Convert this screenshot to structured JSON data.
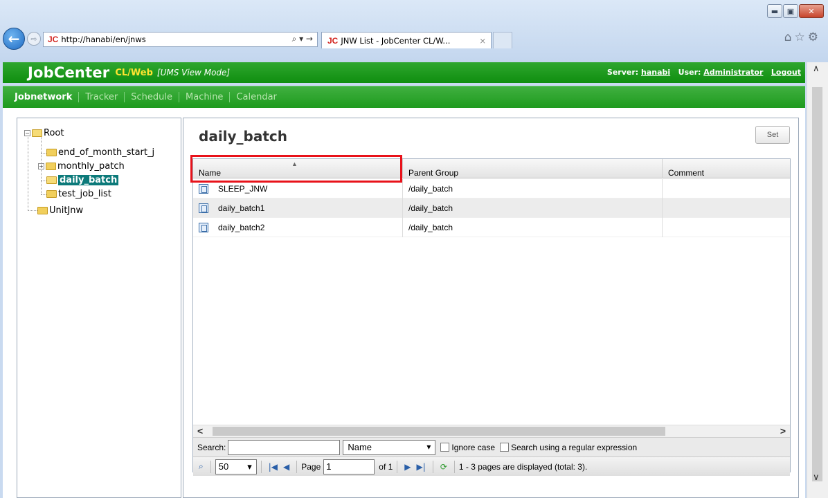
{
  "browser": {
    "url": "http://hanabi/en/jnws",
    "address_tools": "⌕ ▾ →",
    "tab_title": "JNW List - JobCenter CL/W...",
    "tab_close": "×",
    "favicon": "JC",
    "window_buttons": {
      "minimize": "▬",
      "maximize": "▣",
      "close": "✕"
    }
  },
  "app": {
    "logo": "JobCenter",
    "logo_sub": "CL/Web",
    "mode": "[UMS View Mode]",
    "server_label": "Server:",
    "server": "hanabi",
    "user_label": "User:",
    "user": "Administrator",
    "logout": "Logout"
  },
  "nav": [
    "Jobnetwork",
    "Tracker",
    "Schedule",
    "Machine",
    "Calendar"
  ],
  "tree": {
    "root": "Root",
    "children": [
      "end_of_month_start_j",
      "monthly_patch",
      "daily_batch",
      "test_job_list"
    ],
    "sibling": "UnitJnw"
  },
  "panel": {
    "title": "daily_batch",
    "set_label": "Set"
  },
  "grid": {
    "columns": [
      "Name",
      "Parent Group",
      "Comment"
    ],
    "rows": [
      {
        "name": "SLEEP_JNW",
        "parent": "/daily_batch",
        "comment": ""
      },
      {
        "name": "daily_batch1",
        "parent": "/daily_batch",
        "comment": ""
      },
      {
        "name": "daily_batch2",
        "parent": "/daily_batch",
        "comment": ""
      }
    ],
    "sort_arrow": "▲"
  },
  "search": {
    "label": "Search:",
    "field": "Name",
    "ignore_case": "Ignore case",
    "regex": "Search using a regular expression"
  },
  "pager": {
    "page_size": "50",
    "page_label": "Page",
    "page": "1",
    "of_label": "of 1",
    "status": "1 - 3 pages are displayed (total: 3)."
  }
}
